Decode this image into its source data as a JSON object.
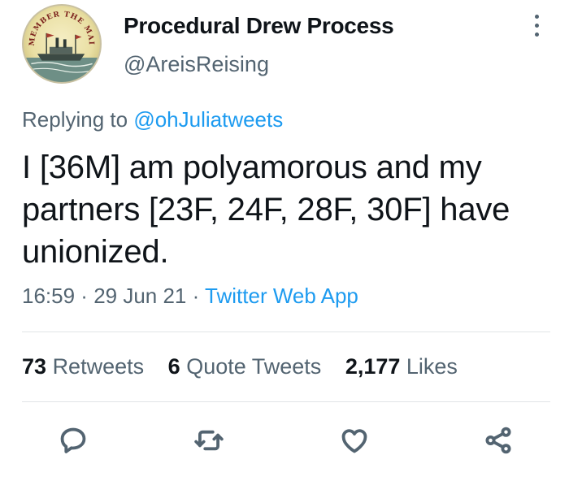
{
  "author": {
    "display_name": "Procedural Drew Process",
    "handle": "@AreisReising",
    "avatar_text": "REMEMBER THE MAINE"
  },
  "reply": {
    "prefix": "Replying to",
    "to": "@ohJuliatweets"
  },
  "tweet": {
    "lines": [
      "I [36M] am polyamorous and my",
      "partners [23F, 24F, 28F, 30F] have",
      "unionized."
    ]
  },
  "meta": {
    "time": "16:59",
    "sep1": " · ",
    "date": "29 Jun 21",
    "sep2": " · ",
    "source": "Twitter Web App"
  },
  "stats": {
    "retweets": {
      "count": "73",
      "label": "Retweets"
    },
    "quotes": {
      "count": "6",
      "label": "Quote Tweets"
    },
    "likes": {
      "count": "2,177",
      "label": "Likes"
    }
  },
  "icons": {
    "reply": "reply-icon",
    "retweet": "retweet-icon",
    "like": "heart-icon",
    "share": "share-icon",
    "more": "more-icon"
  },
  "colors": {
    "text": "#0f1419",
    "secondary": "#536471",
    "link": "#1d9bf0",
    "divider": "#e1e4e6"
  }
}
